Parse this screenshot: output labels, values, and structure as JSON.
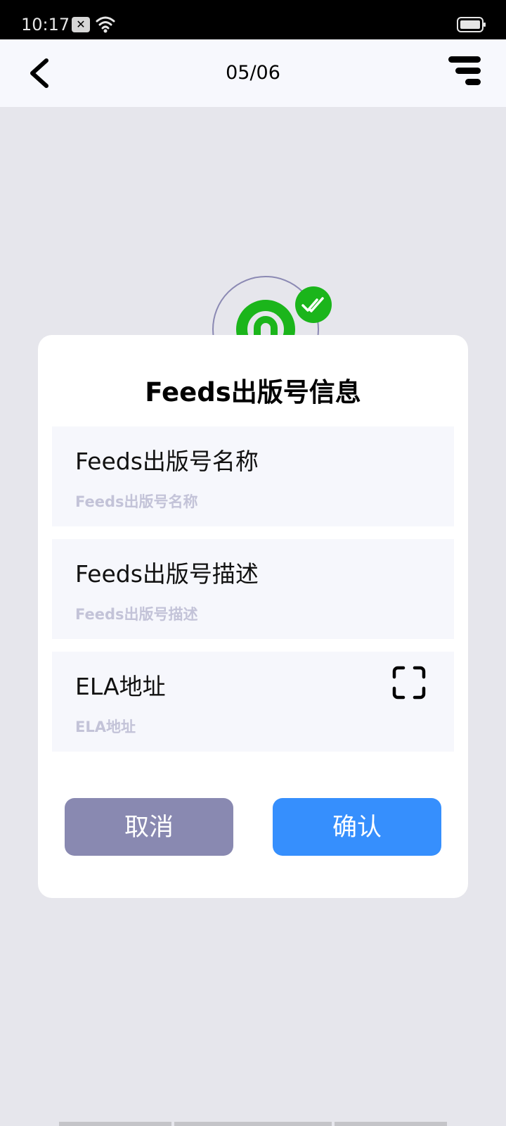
{
  "status_bar": {
    "time": "10:17",
    "notification_icon": "close-icon",
    "wifi_icon": "wifi-icon",
    "battery_icon": "battery-icon"
  },
  "header": {
    "page_counter": "05/06",
    "back_icon": "chevron-left-icon",
    "menu_icon": "menu-lines-icon"
  },
  "avatar": {
    "icon": "feeds-logo-icon",
    "badge_icon": "double-check-icon",
    "brand_color": "#1bb51b"
  },
  "dialog": {
    "title": "Feeds出版号信息",
    "fields": [
      {
        "label": "Feeds出版号名称",
        "placeholder": "Feeds出版号名称",
        "value": ""
      },
      {
        "label": "Feeds出版号描述",
        "placeholder": "Feeds出版号描述",
        "value": ""
      },
      {
        "label": "ELA地址",
        "placeholder": "ELA地址",
        "value": "",
        "action_icon": "scan-icon"
      }
    ],
    "cancel_label": "取消",
    "confirm_label": "确认"
  },
  "colors": {
    "cancel_button": "#8989b1",
    "confirm_button": "#368ffd",
    "field_background": "#f6f7fc",
    "page_background": "#e6e6ec"
  }
}
